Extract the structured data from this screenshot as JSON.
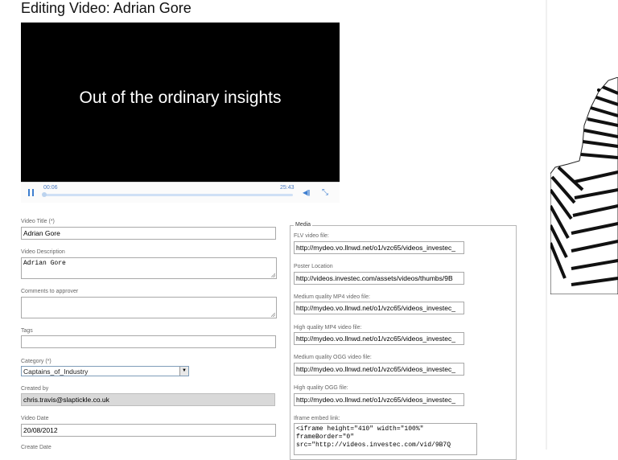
{
  "page": {
    "title": "Editing Video: Adrian Gore"
  },
  "player": {
    "caption": "Out of the ordinary insights",
    "current_time": "00:06",
    "duration": "25:43",
    "progress": 0.004
  },
  "form": {
    "video_title": {
      "label": "Video Title (*)",
      "value": "Adrian Gore"
    },
    "video_description": {
      "label": "Video Description",
      "value": "Adrian Gore"
    },
    "comments": {
      "label": "Comments to approver",
      "value": ""
    },
    "tags": {
      "label": "Tags",
      "value": ""
    },
    "category": {
      "label": "Category (*)",
      "value": "Captains_of_Industry"
    },
    "created_by": {
      "label": "Created by",
      "value": "chris.travis@slaptickle.co.uk"
    },
    "video_date": {
      "label": "Video Date",
      "value": "20/08/2012"
    },
    "create_date": {
      "label": "Create Date"
    }
  },
  "media": {
    "legend": "Media",
    "flv": {
      "label": "FLV video file:",
      "value": "http://mydeo.vo.llnwd.net/o1/vzc65/videos_investec_"
    },
    "poster": {
      "label": "Poster Location",
      "value": "http://videos.investec.com/assets/videos/thumbs/9B"
    },
    "mp4_medium": {
      "label": "Medium quality MP4 video file:",
      "value": "http://mydeo.vo.llnwd.net/o1/vzc65/videos_investec_"
    },
    "mp4_high": {
      "label": "High quality MP4 video file:",
      "value": "http://mydeo.vo.llnwd.net/o1/vzc65/videos_investec_"
    },
    "ogg_medium": {
      "label": "Medium quality OGG video file:",
      "value": "http://mydeo.vo.llnwd.net/o1/vzc65/videos_investec_"
    },
    "ogg_high": {
      "label": "High quality OGG file:",
      "value": "http://mydeo.vo.llnwd.net/o1/vzc65/videos_investec_"
    },
    "iframe": {
      "label": "Iframe embed link:",
      "value": "<iframe height=\"410\" width=\"100%\"\nframeBorder=\"0\"\nsrc=\"http://videos.investec.com/vid/9B7Q"
    }
  },
  "colors": {
    "accent": "#3f7fd0",
    "player_bg": "#000000"
  },
  "icons": [
    "pause-icon",
    "volume-icon",
    "fullscreen-icon",
    "chevron-down-icon",
    "zebra-image"
  ]
}
